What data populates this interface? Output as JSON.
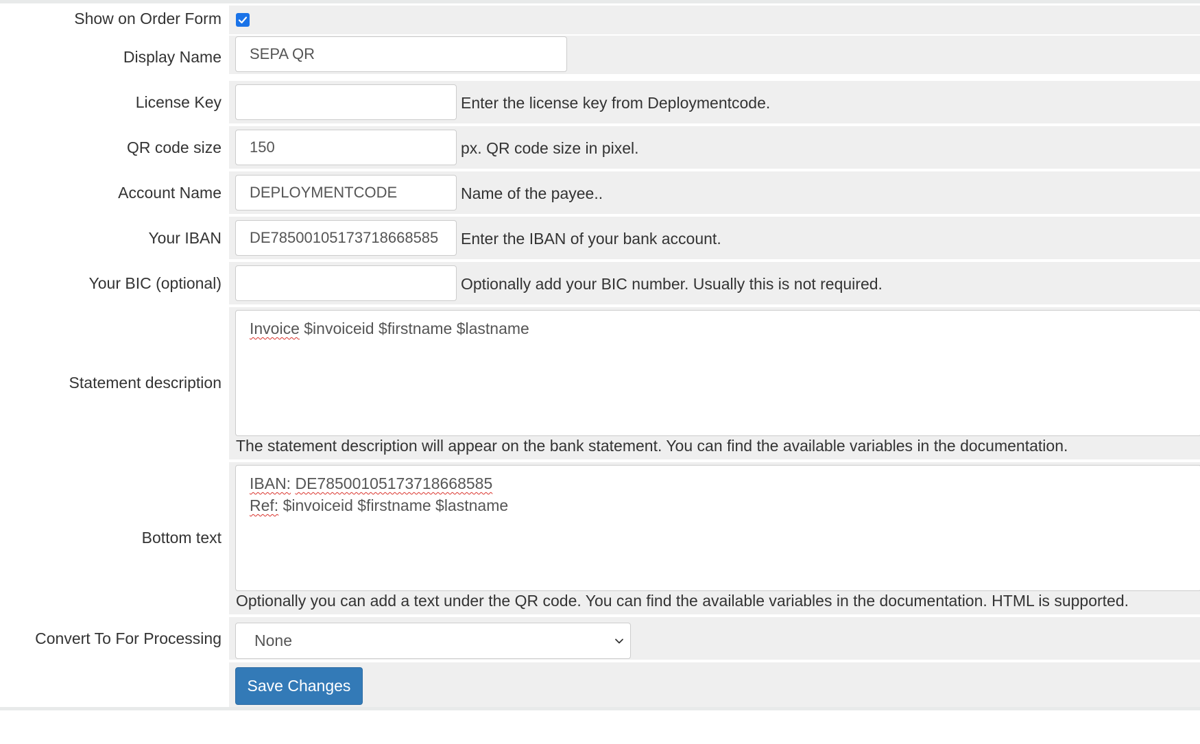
{
  "form": {
    "show_on_order_form": {
      "label": "Show on Order Form",
      "checked": true
    },
    "display_name": {
      "label": "Display Name",
      "value": "SEPA QR"
    },
    "license_key": {
      "label": "License Key",
      "value": "",
      "help": "Enter the license key from Deploymentcode."
    },
    "qr_code_size": {
      "label": "QR code size",
      "value": "150",
      "help": "px. QR code size in pixel."
    },
    "account_name": {
      "label": "Account Name",
      "value": "DEPLOYMENTCODE",
      "help": "Name of the payee.."
    },
    "iban": {
      "label": "Your IBAN",
      "value": "DE78500105173718668585",
      "help": "Enter the IBAN of your bank account."
    },
    "bic": {
      "label": "Your BIC (optional)",
      "value": "",
      "help": "Optionally add your BIC number. Usually this is not required."
    },
    "statement_description": {
      "label": "Statement description",
      "words": [
        "Invoice",
        "$invoiceid",
        "$firstname",
        "$lastname"
      ],
      "help": "The statement description will appear on the bank statement. You can find the available variables in the documentation."
    },
    "bottom_text": {
      "label": "Bottom text",
      "line1_words": [
        "IBAN:",
        "DE78500105173718668585"
      ],
      "line2_words": [
        "Ref:",
        "$invoiceid",
        "$firstname",
        "$lastname"
      ],
      "help": "Optionally you can add a text under the QR code. You can find the available variables in the documentation. HTML is supported."
    },
    "convert_to": {
      "label": "Convert To For Processing",
      "value": "None"
    },
    "save_button": "Save Changes"
  },
  "colors": {
    "primary": "#337ab7",
    "checkbox": "#1a73e8",
    "field_bg": "#efefef",
    "spellcheck": "#d9312a"
  },
  "icons": {
    "checkbox": "checkmark-icon",
    "select": "chevron-down-icon"
  }
}
